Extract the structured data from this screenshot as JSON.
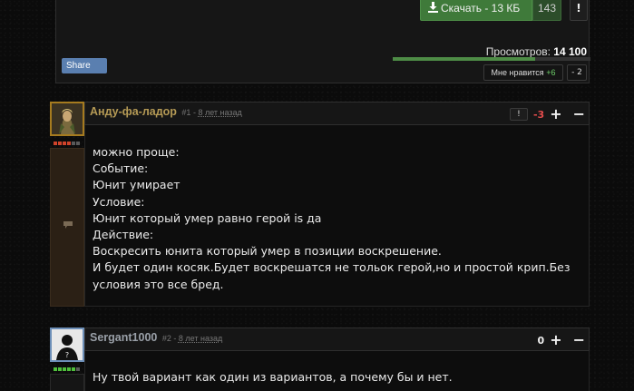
{
  "file_panel": {
    "download_label": "Скачать - 13 КБ",
    "download_count": "143",
    "report_label": "!",
    "share_label": "Share",
    "views_label": "Просмотров:",
    "views_value": "14 100",
    "views_fill": 0.72,
    "like_label": "Мне нравится",
    "like_value": "+6",
    "dislike_value": "- 2"
  },
  "comments": [
    {
      "author": "Анду-фа-ладор",
      "number": "#1",
      "separator": "-",
      "ago": "8 лет назад",
      "report_label": "!",
      "score": "-3",
      "plus": "+",
      "minus": "−",
      "rank_on": 4,
      "rank_total": 6,
      "text_lines": [
        "можно проще:",
        "Событие:",
        "Юнит умирает",
        "Условие:",
        "Юнит который умер равно герой is да",
        "Действие:",
        "Воскресить юнита который умер в позиции воскрешение.",
        "И будет один косяк.Будет воскрешатся не тольок герой,но и простой крип.Без",
        "условия это все бред."
      ]
    },
    {
      "author": "Sergant1000",
      "number": "#2",
      "separator": "-",
      "ago": "8 лет назад",
      "score": "0",
      "plus": "+",
      "minus": "−",
      "rank_on": 5,
      "rank_total": 6,
      "text_lines": [
        "Ну твой вариант как один из вариантов, а почему бы и нет."
      ]
    }
  ],
  "colors": {
    "download_bg": "#3f7a3a",
    "author1": "#b59a55",
    "author2": "#9aa0a8",
    "negative_score": "#e24c4c",
    "share_bg": "#5a7fb0"
  },
  "icons": [
    "download-icon",
    "chat-icon",
    "avatar-elf",
    "avatar-silhouette"
  ]
}
